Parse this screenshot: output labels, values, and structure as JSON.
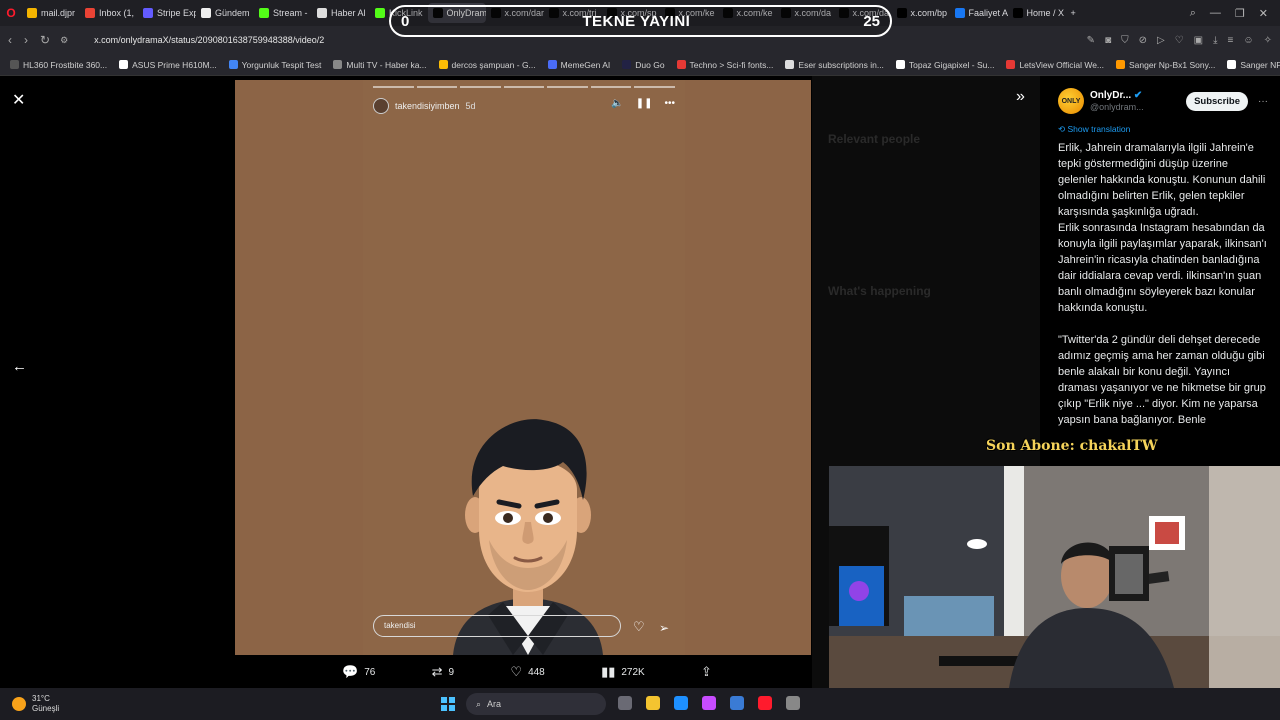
{
  "browser": {
    "tabs": [
      {
        "label": "mail.djpr",
        "color": "#f4b400"
      },
      {
        "label": "Inbox (1,",
        "color": "#ea4335"
      },
      {
        "label": "Stripe Exp",
        "color": "#635bff"
      },
      {
        "label": "Gündem",
        "color": "#eeeeee"
      },
      {
        "label": "Stream -",
        "color": "#53fc18"
      },
      {
        "label": "Haber Al",
        "color": "#dddddd"
      },
      {
        "label": "KickLink",
        "color": "#53fc18"
      },
      {
        "label": "OnlyDrama",
        "color": "#000000",
        "active": true
      },
      {
        "label": "x.com/dar",
        "color": "#000000"
      },
      {
        "label": "x.com/tri",
        "color": "#000000"
      },
      {
        "label": "x.com/sp",
        "color": "#000000"
      },
      {
        "label": "x.com/ke",
        "color": "#000000"
      },
      {
        "label": "x.com/ke",
        "color": "#000000"
      },
      {
        "label": "x.com/da",
        "color": "#000000"
      },
      {
        "label": "x.com/da",
        "color": "#000000"
      },
      {
        "label": "x.com/bp",
        "color": "#000000"
      },
      {
        "label": "Faaliyet A",
        "color": "#1877f2"
      },
      {
        "label": "Home / X",
        "color": "#000000"
      }
    ],
    "new_tab": "+",
    "url": "x.com/onlydramaX/status/2090801638759948388/video/2",
    "bookmarks": [
      {
        "label": "HL360 Frostbite 360...",
        "color": "#555555"
      },
      {
        "label": "ASUS Prime H610M...",
        "color": "#ffffff"
      },
      {
        "label": "Yorgunluk Tespit Test",
        "color": "#4285f4"
      },
      {
        "label": "Multi TV - Haber ka...",
        "color": "#888888"
      },
      {
        "label": "dercos şampuan - G...",
        "color": "#fbbc05"
      },
      {
        "label": "MemeGen AI",
        "color": "#4a6cf7"
      },
      {
        "label": "Duo Go",
        "color": "#222244"
      },
      {
        "label": "Techno > Sci-fi fonts...",
        "color": "#e53935"
      },
      {
        "label": "Eser subscriptions in...",
        "color": "#dddddd"
      },
      {
        "label": "Topaz Gigapixel - Su...",
        "color": "#ffffff"
      },
      {
        "label": "LetsView Official We...",
        "color": "#e53935"
      },
      {
        "label": "Sanger Np-Bx1 Sony...",
        "color": "#ff9900"
      },
      {
        "label": "Sanger NP-BX1 So",
        "color": "#ffffff"
      }
    ]
  },
  "stream_overlay": {
    "left_count": "0",
    "title": "TEKNE YAYINI",
    "right_count": "25"
  },
  "story": {
    "username": "takendisiyimben",
    "age": "5d",
    "reply_placeholder": "takendisi",
    "progress_segments": 7
  },
  "actions": {
    "replies": "76",
    "reposts": "9",
    "likes": "448",
    "views": "272K"
  },
  "background_panel": {
    "relevant_people": "Relevant people",
    "whats_happening": "What's happening"
  },
  "tweet": {
    "display_name": "OnlyDr...",
    "handle": "@onlydram...",
    "subscribe_label": "Subscribe",
    "show_translation": "Show translation",
    "paragraphs": [
      "Erlik, Jahrein dramalarıyla ilgili Jahrein'e tepki göstermediğini düşüp üzerine gelenler hakkında konuştu. Konunun dahili olmadığını belirten Erlik, gelen tepkiler karşısında şaşkınlığa uğradı.",
      "Erlik sonrasında Instagram hesabından da konuyla ilgili paylaşımlar yaparak, ilkinsan'ı Jahrein'in ricasıyla chatinden banladığına dair iddialara cevap verdi. ilkinsan'ın şuan banlı olmadığını söyleyerek bazı konular hakkında konuştu.",
      "\"Twitter'da 2 gündür deli dehşet derecede adımız geçmiş ama her zaman olduğu gibi benle alakalı bir konu değil. Yayıncı draması yaşanıyor ve ne hikmetse bir grup çıkıp \"Erlik niye ...\" diyor. Kim ne yaparsa yapsın bana bağlanıyor. Benle"
    ]
  },
  "son_abone": "Son Abone: chakalTW",
  "taskbar": {
    "temp": "31°C",
    "condition": "Güneşli",
    "search_placeholder": "Ara"
  }
}
